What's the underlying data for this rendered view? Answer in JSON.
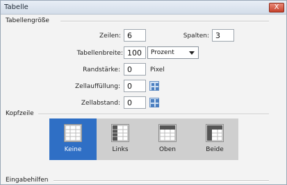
{
  "window": {
    "title": "Tabelle",
    "close_glyph": "X"
  },
  "sections": {
    "size": "Tabellengröße",
    "header": "Kopfzeile",
    "accessibility": "Eingabehilfen"
  },
  "form": {
    "rows_label": "Zeilen:",
    "rows_value": "6",
    "cols_label": "Spalten:",
    "cols_value": "3",
    "width_label": "Tabellenbreite:",
    "width_value": "100",
    "width_unit": "Prozent",
    "border_label": "Randstärke:",
    "border_value": "0",
    "border_unit": "Pixel",
    "padding_label": "Zellauffüllung:",
    "padding_value": "0",
    "spacing_label": "Zellabstand:",
    "spacing_value": "0"
  },
  "header_options": [
    {
      "label": "Keine",
      "selected": true
    },
    {
      "label": "Links",
      "selected": false
    },
    {
      "label": "Oben",
      "selected": false
    },
    {
      "label": "Beide",
      "selected": false
    }
  ],
  "colors": {
    "accent": "#2f6fc5",
    "close": "#c6412b"
  }
}
